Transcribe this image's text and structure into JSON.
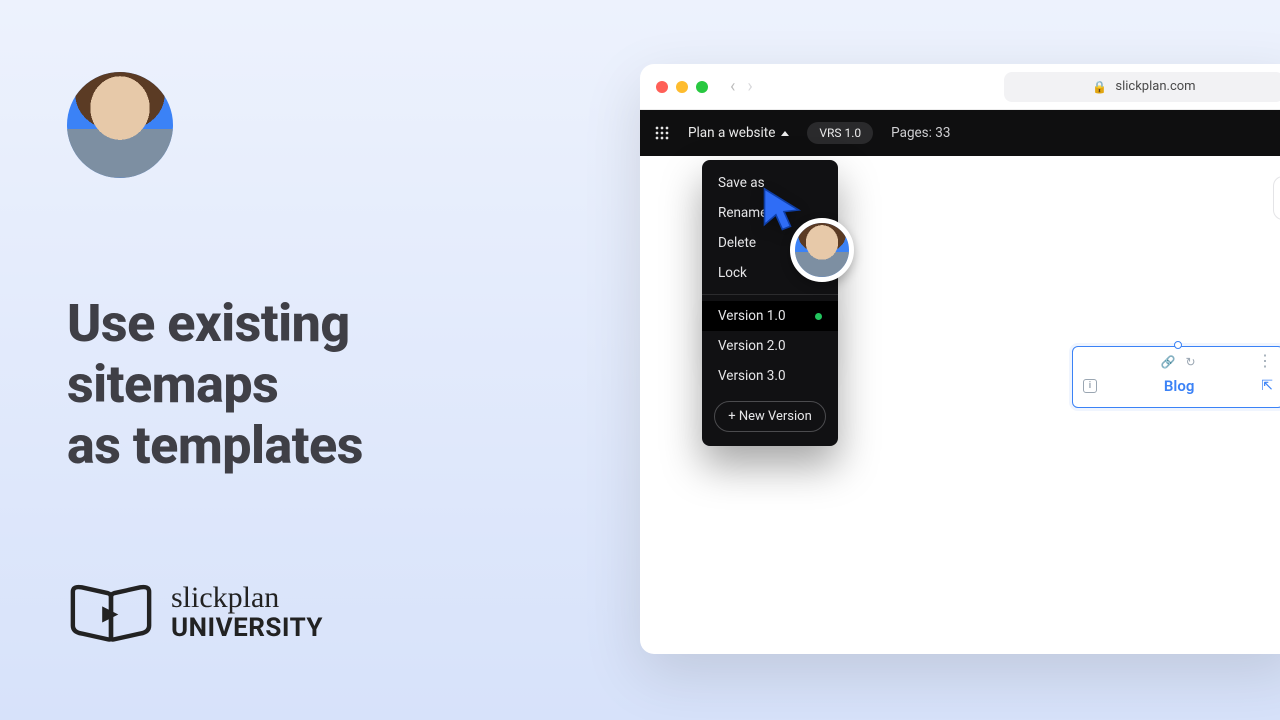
{
  "headline": {
    "line1": "Use existing",
    "line2": "sitemaps",
    "line3": "as templates"
  },
  "brand": {
    "script": "slickplan",
    "caps": "UNIVERSITY"
  },
  "browser": {
    "url": "slickplan.com"
  },
  "appbar": {
    "project_name": "Plan a website",
    "version_pill": "VRS 1.0",
    "pages_label": "Pages: 33"
  },
  "dropdown": {
    "items": [
      "Save as",
      "Rename",
      "Delete",
      "Lock"
    ],
    "versions": [
      "Version 1.0",
      "Version 2.0",
      "Version 3.0"
    ],
    "active_version_index": 0,
    "new_version_label": "+ New Version"
  },
  "node": {
    "label": "Blog"
  }
}
